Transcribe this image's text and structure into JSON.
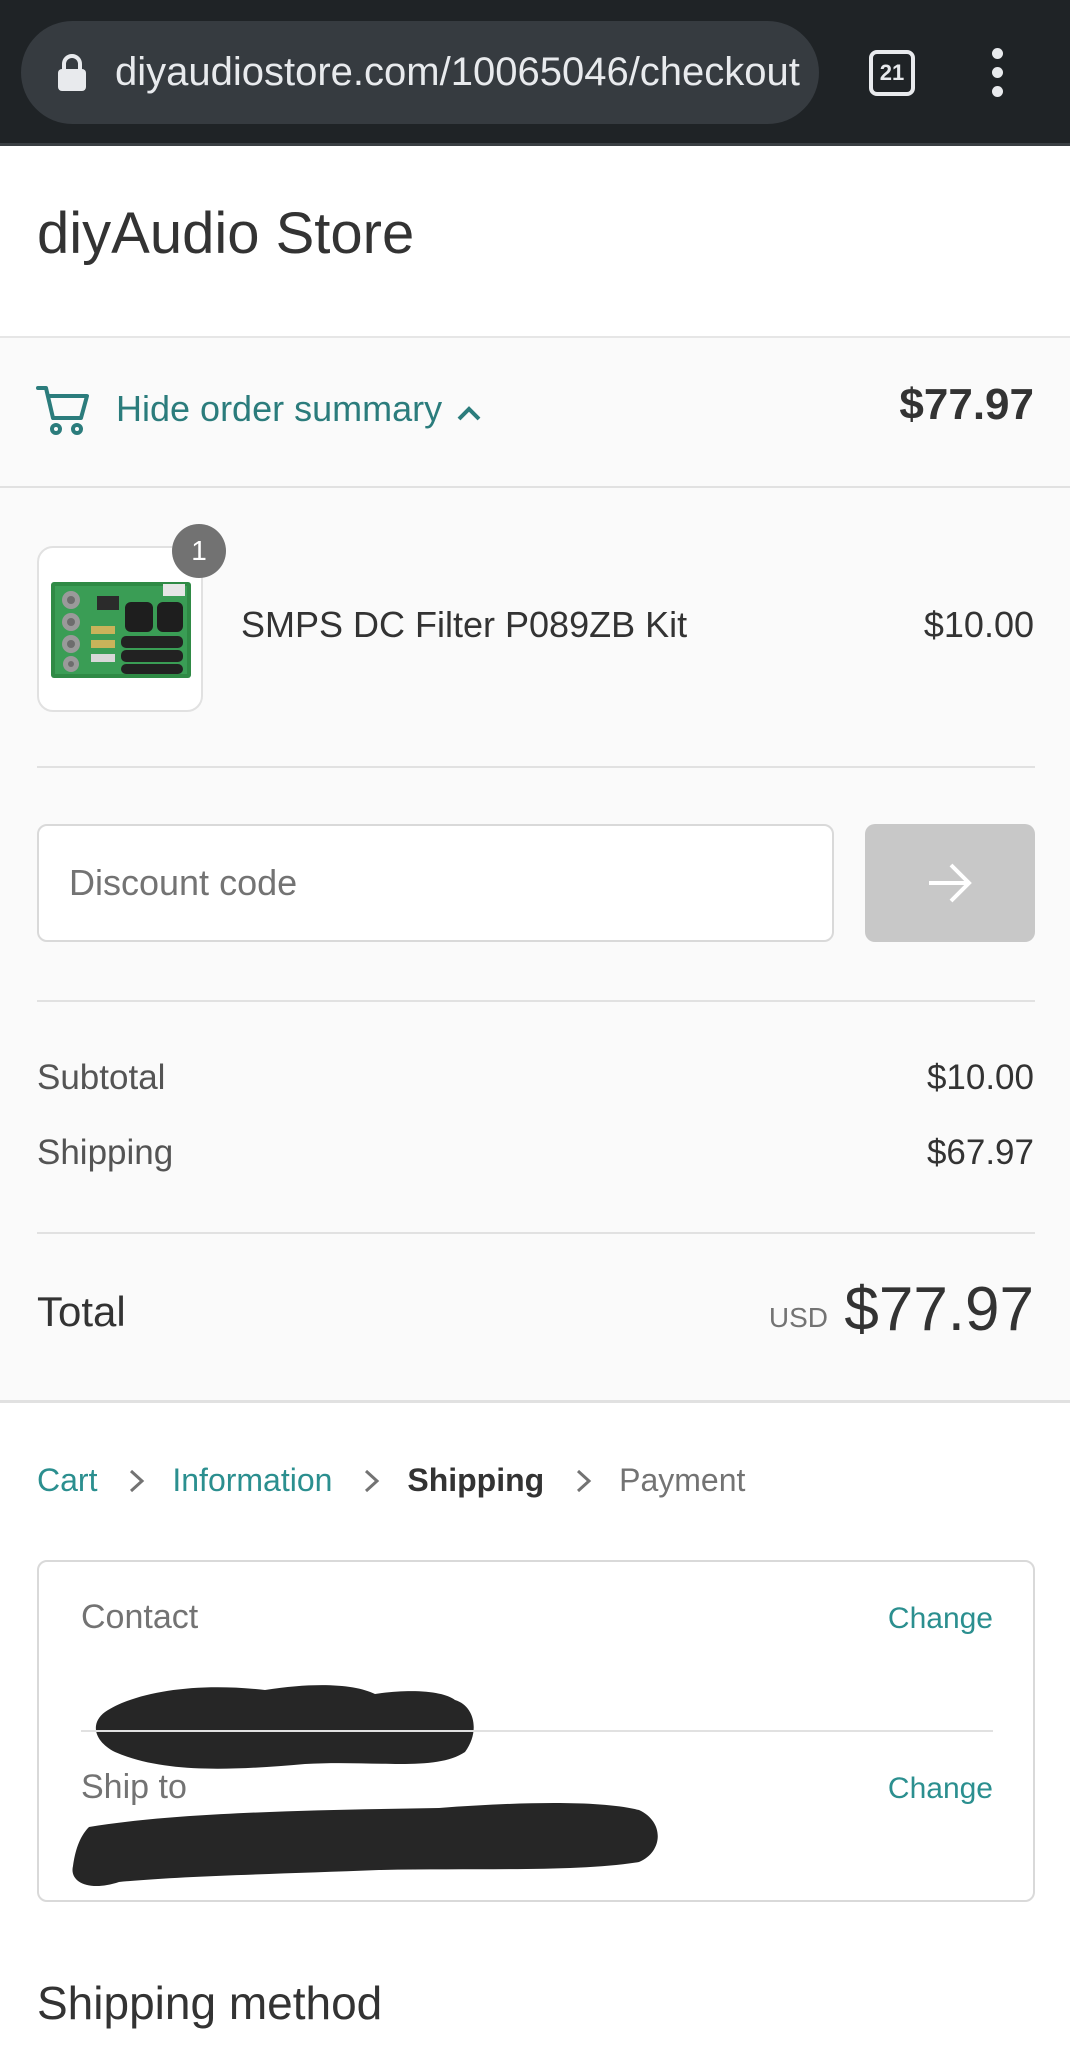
{
  "browser": {
    "url": "diyaudiostore.com/10065046/checkout",
    "tab_count": "21"
  },
  "header": {
    "store_name": "diyAudio Store"
  },
  "summary_toggle": {
    "label": "Hide order summary",
    "total": "$77.97"
  },
  "order": {
    "items": [
      {
        "quantity": "1",
        "name": "SMPS DC Filter P089ZB Kit",
        "price": "$10.00"
      }
    ],
    "discount": {
      "placeholder": "Discount code",
      "value": ""
    },
    "subtotal": {
      "label": "Subtotal",
      "value": "$10.00"
    },
    "shipping": {
      "label": "Shipping",
      "value": "$67.97"
    },
    "total": {
      "label": "Total",
      "currency": "USD",
      "value": "$77.97"
    }
  },
  "breadcrumb": {
    "steps": [
      {
        "label": "Cart",
        "state": "link"
      },
      {
        "label": "Information",
        "state": "link"
      },
      {
        "label": "Shipping",
        "state": "current"
      },
      {
        "label": "Payment",
        "state": "future"
      }
    ]
  },
  "review": {
    "contact": {
      "label": "Contact",
      "action": "Change"
    },
    "ship_to": {
      "label": "Ship to",
      "action": "Change"
    }
  },
  "shipping_method": {
    "title": "Shipping method"
  },
  "colors": {
    "accent": "#2b8f8f",
    "toggle_text": "#2b7c7c",
    "chrome": "#1f2326"
  },
  "icons": [
    "lock-icon",
    "tab-switcher-icon",
    "more-vert-icon",
    "cart-icon",
    "chevron-up-icon",
    "arrow-right-icon",
    "chevron-right-icon"
  ]
}
